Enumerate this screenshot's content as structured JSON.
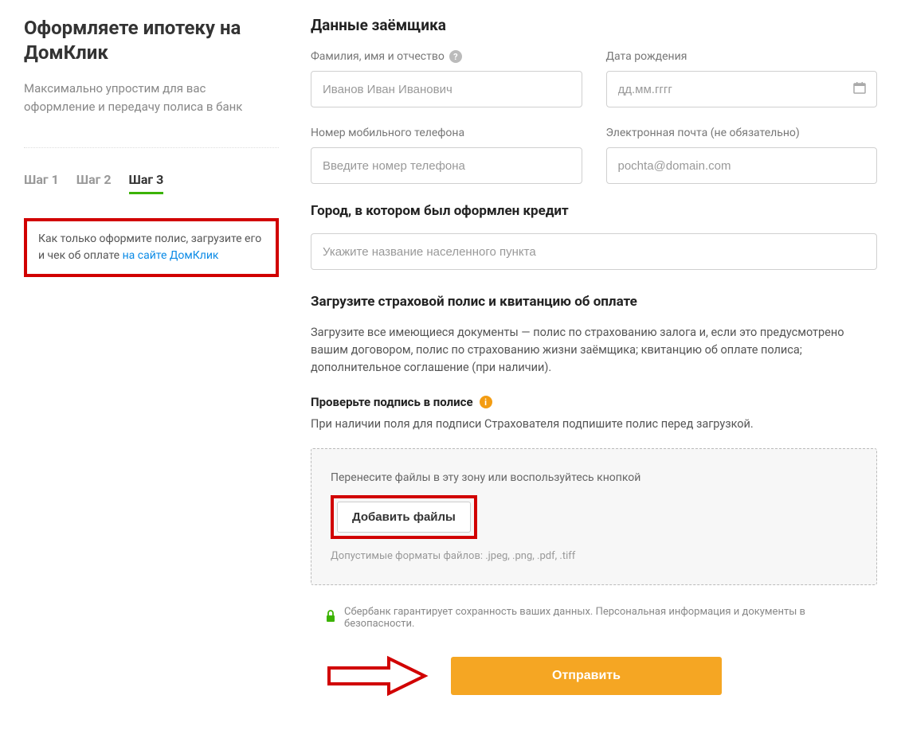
{
  "sidebar": {
    "title": "Оформляете ипотеку на ДомКлик",
    "subtitle": "Максимально упростим для вас оформление и передачу полиса в банк",
    "steps": [
      "Шаг 1",
      "Шаг 2",
      "Шаг 3"
    ],
    "active_step_index": 2,
    "notice_text": "Как только оформите полис, загрузите его и чек об оплате ",
    "notice_link": "на сайте ДомКлик"
  },
  "borrower": {
    "heading": "Данные заёмщика",
    "fullname_label": "Фамилия, имя и отчество",
    "fullname_placeholder": "Иванов Иван Иванович",
    "dob_label": "Дата рождения",
    "dob_placeholder": "дд.мм.гггг",
    "phone_label": "Номер мобильного телефона",
    "phone_placeholder": "Введите номер телефона",
    "email_label": "Электронная почта (не обязательно)",
    "email_placeholder": "pochta@domain.com"
  },
  "city": {
    "heading": "Город, в котором был оформлен кредит",
    "placeholder": "Укажите название населенного пункта"
  },
  "upload": {
    "heading": "Загрузите страховой полис и квитанцию об оплате",
    "desc": "Загрузите все имеющиеся документы — полис по страхованию залога и, если это предусмотрено вашим договором, полис по страхованию жизни заёмщика; квитанцию об оплате полиса; дополнительное соглашение (при наличии).",
    "check_sign_label": "Проверьте подпись в полисе",
    "sign_desc": "При наличии поля для подписи Страхователя подпишите полис перед загрузкой.",
    "dropzone_text": "Перенесите файлы в эту зону или воспользуйтесь кнопкой",
    "add_files_label": "Добавить файлы",
    "formats": "Допустимые форматы файлов: .jpeg, .png, .pdf, .tiff"
  },
  "security_note": "Сбербанк гарантирует сохранность ваших данных. Персональная информация и документы в безопасности.",
  "submit_label": "Отправить"
}
